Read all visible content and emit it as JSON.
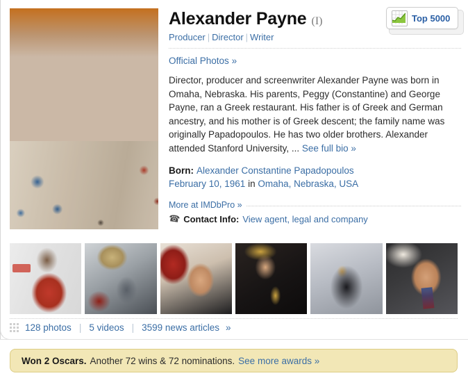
{
  "person": {
    "name": "Alexander Payne",
    "name_suffix": "(I)",
    "jobs": [
      "Producer",
      "Director",
      "Writer"
    ],
    "job_separator": "|"
  },
  "badge": {
    "label": "Top 5000",
    "icon": "chart-icon",
    "accent_color": "#2a5fa5",
    "chart_color": "#8cc63f"
  },
  "links": {
    "official_photos": "Official Photos",
    "chevron": "»",
    "see_full_bio": "See full bio",
    "more_at_imdbpro": "More at IMDbPro"
  },
  "bio": {
    "text": "Director, producer and screenwriter Alexander Payne was born in Omaha, Nebraska. His parents, Peggy (Constantine) and George Payne, ran a Greek restaurant. His father is of Greek and German ancestry, and his mother is of Greek descent; the family name was originally Papadopoulos. He has two older brothers. Alexander attended Stanford University, ...",
    "more_label": "See full bio »"
  },
  "born": {
    "label": "Born:",
    "birth_name": "Alexander Constantine Papadopoulos",
    "date": "February 10, 1961",
    "in_word": "in",
    "place": "Omaha, Nebraska, USA"
  },
  "contact": {
    "icon": "phone-icon",
    "label": "Contact Info:",
    "value": "View agent, legal and company"
  },
  "photos": {
    "grid_icon": "grid-icon",
    "photo_count": "128 photos",
    "video_count": "5 videos",
    "news_count": "3599 news articles",
    "chevron": "»",
    "separator": "|",
    "thumbnails": [
      {
        "name": "thumb-red-carpet-epix"
      },
      {
        "name": "thumb-on-set-camera"
      },
      {
        "name": "thumb-premiere-portrait"
      },
      {
        "name": "thumb-governors-awards"
      },
      {
        "name": "thumb-group-with-oscars"
      },
      {
        "name": "thumb-festival-interview"
      }
    ]
  },
  "awards": {
    "won": "Won 2 Oscars.",
    "detail": "Another 72 wins & 72 nominations.",
    "more": "See more awards »",
    "background": "#f2e7b6",
    "border": "#ddcd84"
  }
}
